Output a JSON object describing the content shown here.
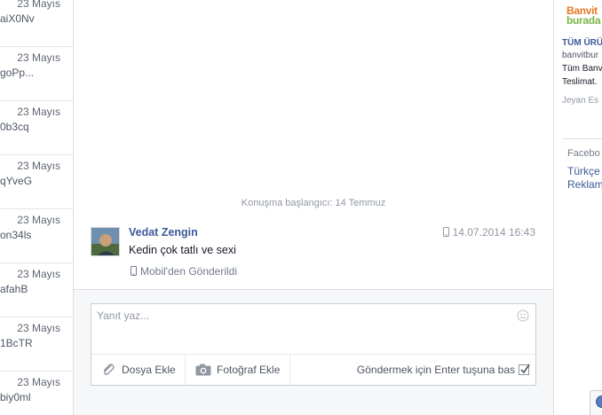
{
  "threads": [
    {
      "date": "23 Mayıs",
      "snippet": "aiX0Nv"
    },
    {
      "date": "23 Mayıs",
      "snippet": "goPp..."
    },
    {
      "date": "23 Mayıs",
      "snippet": "0b3cq"
    },
    {
      "date": "23 Mayıs",
      "snippet": "qYveG"
    },
    {
      "date": "23 Mayıs",
      "snippet": "on34ls"
    },
    {
      "date": "23 Mayıs",
      "snippet": "afahB"
    },
    {
      "date": "23 Mayıs",
      "snippet": "1BcTR"
    },
    {
      "date": "23 Mayıs",
      "snippet": "biy0ml"
    }
  ],
  "conversation": {
    "start_label": "Konuşma başlangıcı: 14 Temmuz",
    "message": {
      "sender": "Vedat Zengin",
      "timestamp": "14.07.2014 16:43",
      "text": "Kedin çok tatlı ve sexi",
      "source": "Mobil'den Gönderildi"
    }
  },
  "composer": {
    "placeholder": "Yanıt yaz...",
    "attach_file_label": "Dosya Ekle",
    "attach_photo_label": "Fotoğraf Ekle",
    "enter_to_send_label": "Göndermek için Enter tuşuna bas",
    "enter_to_send_checked": true
  },
  "right_column": {
    "ad": {
      "logo_line1": "Banvit",
      "logo_line2": "burada",
      "title": "TÜM ÜRÜ",
      "url": "banvitbur",
      "body_line1": "Tüm Banv",
      "body_line2": "Teslimat.",
      "social": "Jeyan Es"
    },
    "footer": {
      "brand": "Facebo",
      "language": "Türkçe",
      "ads": "Reklam"
    }
  },
  "colors": {
    "link": "#3b5998",
    "muted": "#9197a3",
    "composer_bg": "#f6f7f8",
    "ad_orange": "#e87722",
    "ad_green": "#7ab648"
  }
}
